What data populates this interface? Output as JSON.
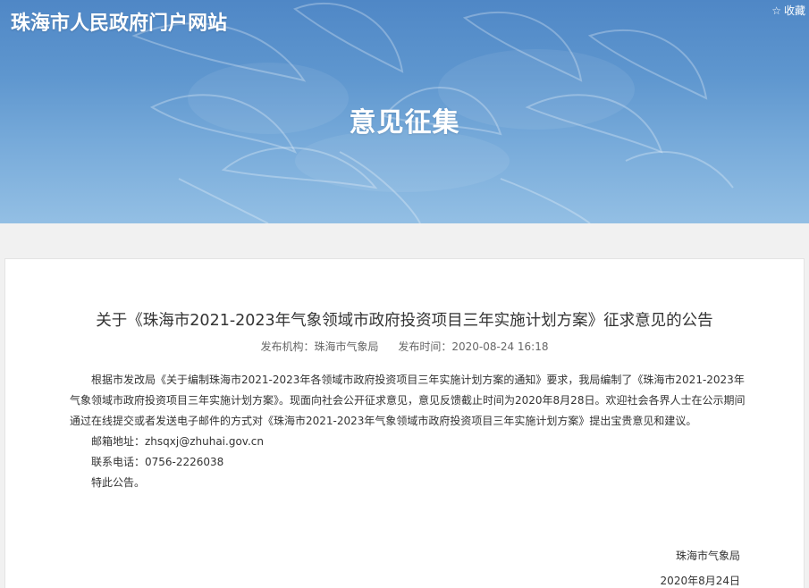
{
  "header": {
    "site_title": "珠海市人民政府门户网站",
    "favorite_label": "收藏",
    "favorite_icon": "star-icon",
    "banner_title": "意见征集"
  },
  "article": {
    "title": "关于《珠海市2021-2023年气象领域市政府投资项目三年实施计划方案》征求意见的公告",
    "publisher_label": "发布机构：珠海市气象局",
    "publish_time_label": "发布时间：2020-08-24 16:18",
    "paragraph": "根据市发改局《关于编制珠海市2021-2023年各领域市政府投资项目三年实施计划方案的通知》要求，我局编制了《珠海市2021-2023年气象领域市政府投资项目三年实施计划方案》。现面向社会公开征求意见，意见反馈截止时间为2020年8月28日。欢迎社会各界人士在公示期间通过在线提交或者发送电子邮件的方式对《珠海市2021-2023年气象领域市政府投资项目三年实施计划方案》提出宝贵意见和建议。",
    "email_line": "邮箱地址：zhsqxj@zhuhai.gov.cn",
    "phone_line": "联系电话：0756-2226038",
    "closing": "特此公告。",
    "signature_org": "珠海市气象局",
    "signature_date": "2020年8月24日"
  }
}
